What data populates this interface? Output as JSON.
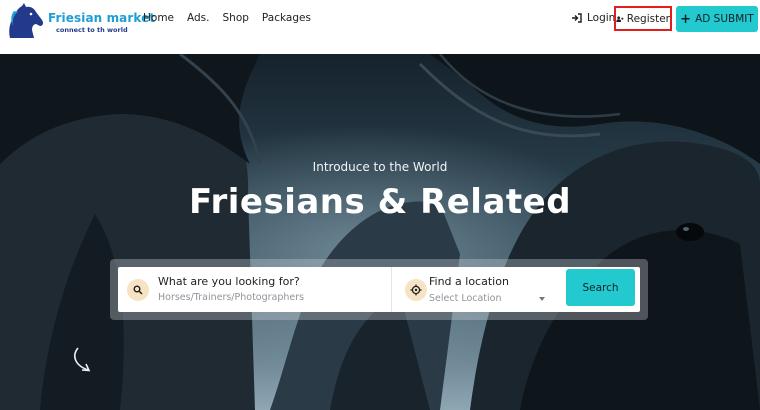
{
  "brand": {
    "name": "Friesian market",
    "tagline": "connect to th world"
  },
  "nav": {
    "items": [
      {
        "label": "Home"
      },
      {
        "label": "Ads."
      },
      {
        "label": "Shop"
      },
      {
        "label": "Packages"
      }
    ]
  },
  "auth": {
    "login_label": "Login",
    "register_label": "Register"
  },
  "cta": {
    "ad_submit_label": "AD SUBMIT"
  },
  "hero": {
    "intro": "Introduce to the World",
    "title": "Friesians & Related"
  },
  "search": {
    "what_label": "What are you looking for?",
    "what_placeholder": "Horses/Trainers/Photographers",
    "location_label": "Find a location",
    "location_selected": "Select Location",
    "button_label": "Search"
  },
  "icons": {
    "logo": "horse-head-icon",
    "login": "sign-in-icon",
    "register": "user-plus-icon",
    "ad_submit": "plus-icon",
    "what": "search-icon",
    "location": "crosshair-icon",
    "dropdown": "caret-down-icon",
    "scroll": "curved-arrow-icon"
  },
  "colors": {
    "accent": "#22c9cf",
    "brand_blue": "#1d9fd6",
    "brand_navy": "#233a8c",
    "highlight_border": "#e31d1d",
    "icon_circle": "#f6e3c3"
  }
}
